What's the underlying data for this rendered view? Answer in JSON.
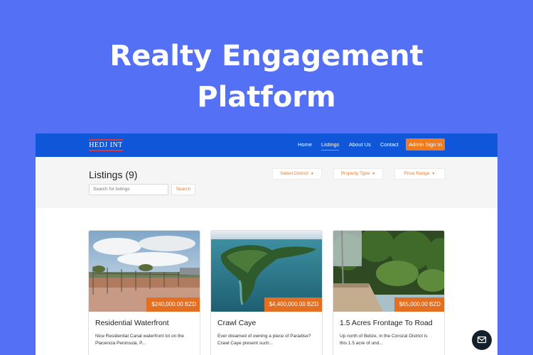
{
  "hero": {
    "title_line1": "Realty Engagement",
    "title_line2": "Platform"
  },
  "navbar": {
    "logo_text": "HEDJ INT",
    "links": [
      "Home",
      "Listings",
      "About Us",
      "Contact"
    ],
    "active_link": "Listings",
    "admin_button": "Admin Sign In"
  },
  "filters": {
    "title": "Listings (9)",
    "search_placeholder": "Search for listings",
    "search_button": "Search",
    "district": "Select District",
    "property_type": "Property Type",
    "price_range": "Price Range"
  },
  "listings": [
    {
      "price": "$240,000.00 BZD",
      "title": "Residential Waterfront",
      "desc_line1": "Nice Residential Canal waterfront lot on the",
      "desc_line2": "Placencia Peninsula, P..."
    },
    {
      "price": "$4,400,000.00 BZD",
      "title": "Crawl Caye",
      "desc_line1": "Ever dreamed of owning a piece of Paradise?",
      "desc_line2": "Crawl Caye present such..."
    },
    {
      "price": "$65,000.00 BZD",
      "title": "1.5 Acres Frontage To Road",
      "desc_line1": "Up north of Belize, in the Corozal District is",
      "desc_line2": "this 1.5 acre of und..."
    }
  ],
  "colors": {
    "background": "#5471f5",
    "navbar": "#0f56d9",
    "accent": "#f07a1e",
    "price_tag": "#e26f22"
  },
  "icons": {
    "chat": "mail-icon",
    "dropdown": "caret-down-icon"
  }
}
